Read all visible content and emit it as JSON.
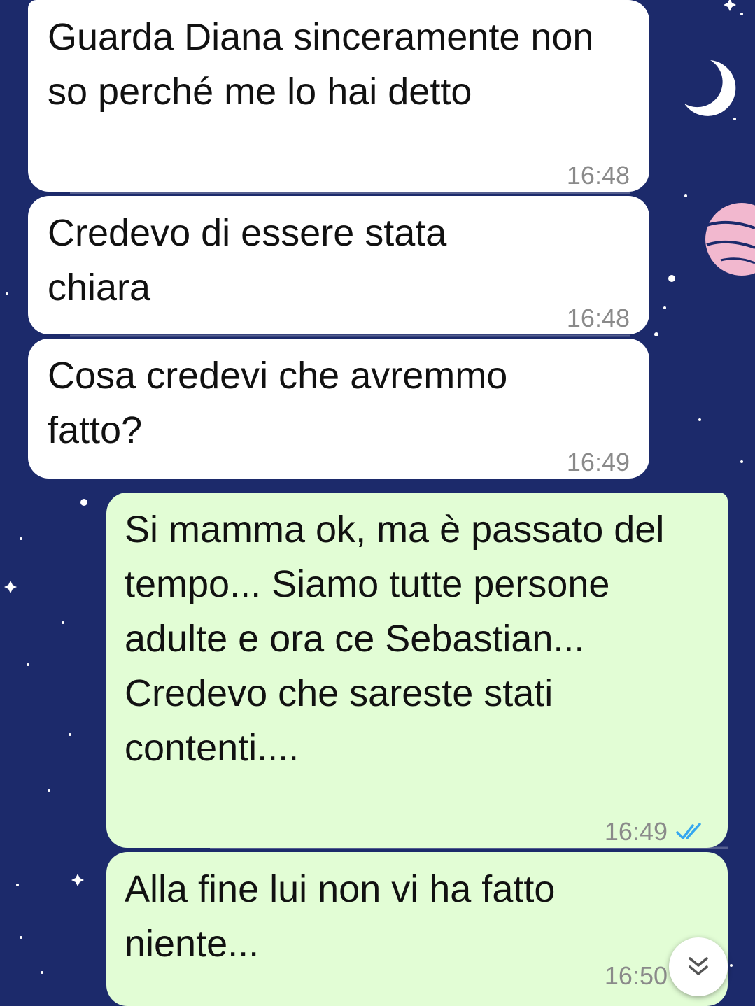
{
  "colors": {
    "background": "#1c2a6b",
    "incoming_bubble": "#ffffff",
    "outgoing_bubble": "#e2fdd5",
    "read_ticks": "#35a7f0"
  },
  "messages": [
    {
      "direction": "incoming",
      "text": "Guarda Diana sinceramente non so perché me lo hai detto",
      "time": "16:48"
    },
    {
      "direction": "incoming",
      "text": "Credevo di essere stata chiara",
      "time": "16:48"
    },
    {
      "direction": "incoming",
      "text": "Cosa credevi che avremmo fatto?",
      "time": "16:49"
    },
    {
      "direction": "outgoing",
      "text": "Si mamma ok, ma è passato del tempo... Siamo tutte persone adulte e ora ce Sebastian... Credevo che sareste stati contenti....",
      "time": "16:49",
      "status_icon": "double-check-read-icon"
    },
    {
      "direction": "outgoing",
      "text": "Alla fine lui non vi ha fatto niente...",
      "time": "16:50",
      "status_icon": "double-check-icon"
    }
  ],
  "scroll_button": {
    "icon": "double-chevron-down-icon"
  }
}
